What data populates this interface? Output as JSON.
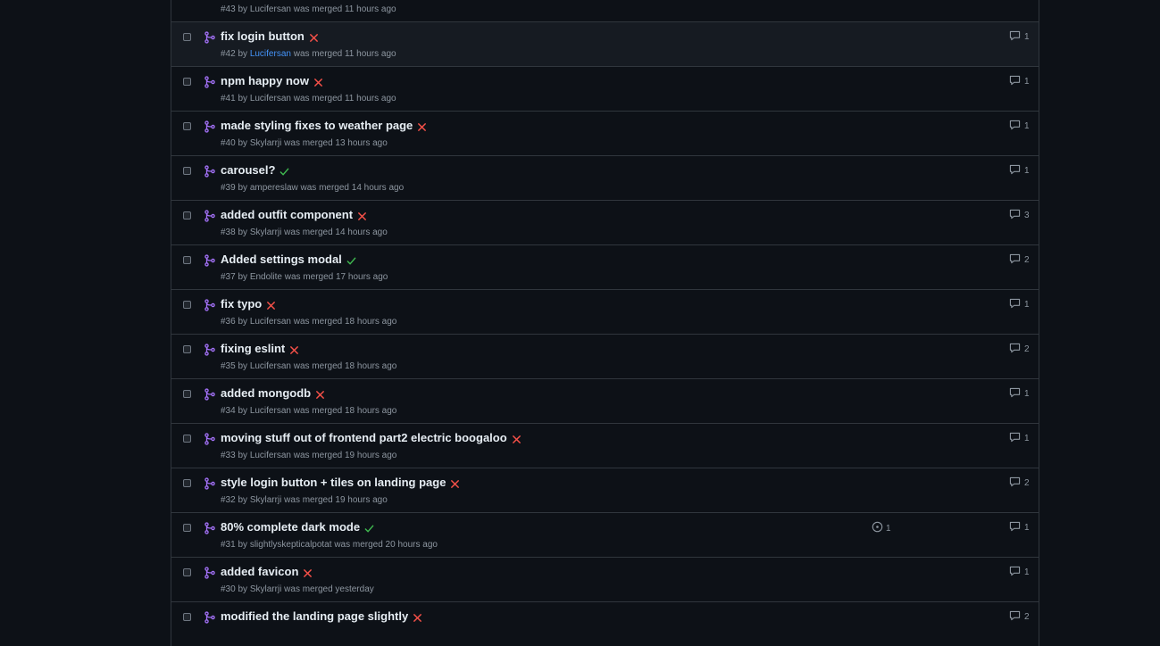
{
  "colors": {
    "background": "#0d1117",
    "merged_icon": "#a371f7",
    "fail": "#f85149",
    "success": "#3fb950",
    "link": "#4493f8",
    "muted": "#8d96a0"
  },
  "pull_requests": [
    {
      "title": "",
      "number": "#43",
      "by": "by",
      "author": "Lucifersan",
      "merged_text": "was merged 11 hours ago",
      "status": "",
      "comments": ""
    },
    {
      "title": "fix login button",
      "number": "#42",
      "by": "by",
      "author": "Lucifersan",
      "merged_text": "was merged 11 hours ago",
      "status": "fail",
      "comments": "1"
    },
    {
      "title": "npm happy now",
      "number": "#41",
      "by": "by",
      "author": "Lucifersan",
      "merged_text": "was merged 11 hours ago",
      "status": "fail",
      "comments": "1"
    },
    {
      "title": "made styling fixes to weather page",
      "number": "#40",
      "by": "by",
      "author": "Skylarrji",
      "merged_text": "was merged 13 hours ago",
      "status": "fail",
      "comments": "1"
    },
    {
      "title": "carousel?",
      "number": "#39",
      "by": "by",
      "author": "ampereslaw",
      "merged_text": "was merged 14 hours ago",
      "status": "success",
      "comments": "1"
    },
    {
      "title": "added outfit component",
      "number": "#38",
      "by": "by",
      "author": "Skylarrji",
      "merged_text": "was merged 14 hours ago",
      "status": "fail",
      "comments": "3"
    },
    {
      "title": "Added settings modal",
      "number": "#37",
      "by": "by",
      "author": "Endolite",
      "merged_text": "was merged 17 hours ago",
      "status": "success",
      "comments": "2"
    },
    {
      "title": "fix typo",
      "number": "#36",
      "by": "by",
      "author": "Lucifersan",
      "merged_text": "was merged 18 hours ago",
      "status": "fail",
      "comments": "1"
    },
    {
      "title": "fixing eslint",
      "number": "#35",
      "by": "by",
      "author": "Lucifersan",
      "merged_text": "was merged 18 hours ago",
      "status": "fail",
      "comments": "2"
    },
    {
      "title": "added mongodb",
      "number": "#34",
      "by": "by",
      "author": "Lucifersan",
      "merged_text": "was merged 18 hours ago",
      "status": "fail",
      "comments": "1"
    },
    {
      "title": "moving stuff out of frontend part2 electric boogaloo",
      "number": "#33",
      "by": "by",
      "author": "Lucifersan",
      "merged_text": "was merged 19 hours ago",
      "status": "fail",
      "comments": "1"
    },
    {
      "title": "style login button + tiles on landing page",
      "number": "#32",
      "by": "by",
      "author": "Skylarrji",
      "merged_text": "was merged 19 hours ago",
      "status": "fail",
      "comments": "2"
    },
    {
      "title": "80% complete dark mode",
      "number": "#31",
      "by": "by",
      "author": "slightlyskepticalpotat",
      "merged_text": "was merged 20 hours ago",
      "status": "success",
      "comments": "1",
      "linked_issues": "1"
    },
    {
      "title": "added favicon",
      "number": "#30",
      "by": "by",
      "author": "Skylarrji",
      "merged_text": "was merged yesterday",
      "status": "fail",
      "comments": "1"
    },
    {
      "title": "modified the landing page slightly",
      "number": "",
      "by": "",
      "author": "",
      "merged_text": "",
      "status": "fail",
      "comments": "2"
    }
  ]
}
